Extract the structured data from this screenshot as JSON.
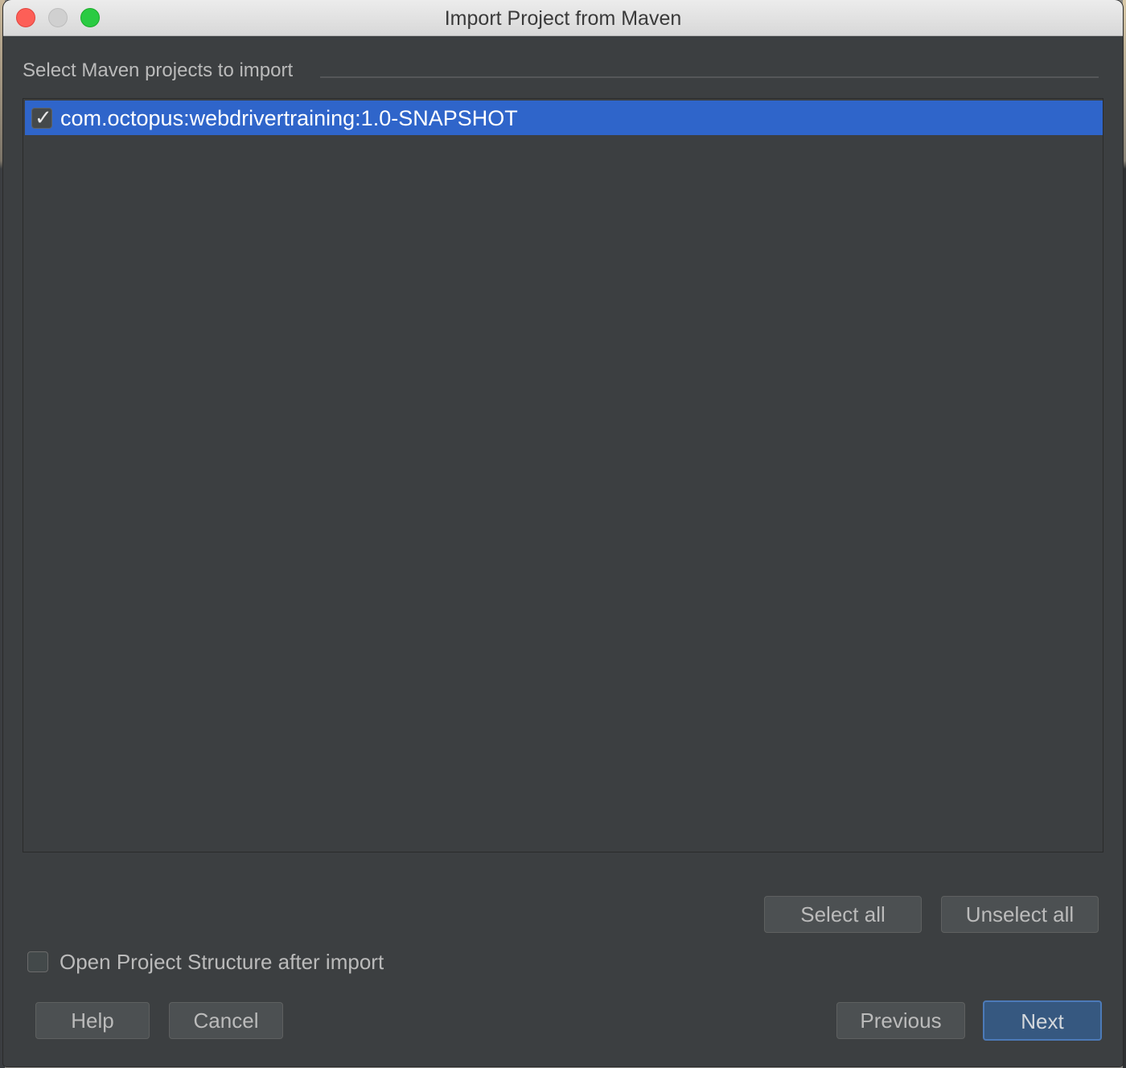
{
  "window": {
    "title": "Import Project from Maven"
  },
  "section": {
    "header": "Select Maven projects to import"
  },
  "projects": [
    {
      "label": "com.octopus:webdrivertraining:1.0-SNAPSHOT",
      "checked": true,
      "selected": true
    }
  ],
  "list_buttons": {
    "select_all": "Select all",
    "unselect_all": "Unselect all"
  },
  "options": {
    "open_structure_label": "Open Project Structure after import",
    "open_structure_checked": false
  },
  "footer": {
    "help": "Help",
    "cancel": "Cancel",
    "previous": "Previous",
    "next": "Next"
  },
  "colors": {
    "dialog_bg": "#3c3f41",
    "selection": "#2f65ca",
    "default_button": "#365880"
  }
}
